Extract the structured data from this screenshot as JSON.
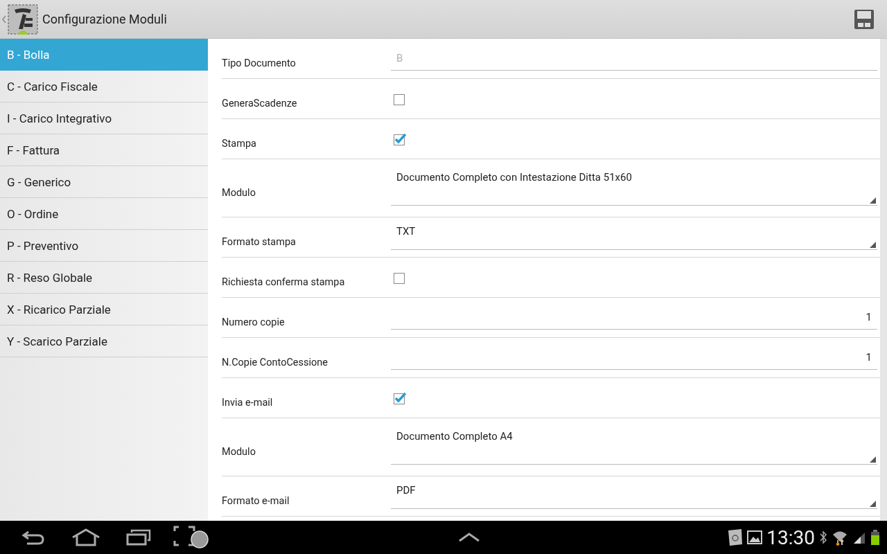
{
  "action_bar": {
    "title": "Configurazione Moduli"
  },
  "sidebar": {
    "items": [
      {
        "label": "B - Bolla",
        "selected": true
      },
      {
        "label": "C - Carico Fiscale",
        "selected": false
      },
      {
        "label": "I - Carico Integrativo",
        "selected": false
      },
      {
        "label": "F - Fattura",
        "selected": false
      },
      {
        "label": "G - Generico",
        "selected": false
      },
      {
        "label": "O - Ordine",
        "selected": false
      },
      {
        "label": "P - Preventivo",
        "selected": false
      },
      {
        "label": "R - Reso Globale",
        "selected": false
      },
      {
        "label": "X - Ricarico Parziale",
        "selected": false
      },
      {
        "label": "Y - Scarico Parziale",
        "selected": false
      }
    ]
  },
  "settings": [
    {
      "kind": "text",
      "label": "Tipo Documento",
      "value": "B",
      "disabled": true
    },
    {
      "kind": "checkbox",
      "label": "GeneraScadenze",
      "checked": false
    },
    {
      "kind": "checkbox",
      "label": "Stampa",
      "checked": true
    },
    {
      "kind": "spinner",
      "label": "Modulo",
      "value": "Documento Completo con Intestazione Ditta 51x60"
    },
    {
      "kind": "spinner",
      "label": "Formato stampa",
      "value": "TXT"
    },
    {
      "kind": "checkbox",
      "label": "Richiesta conferma stampa",
      "checked": false
    },
    {
      "kind": "number",
      "label": "Numero copie",
      "value": "1"
    },
    {
      "kind": "number",
      "label": "N.Copie ContoCessione",
      "value": "1"
    },
    {
      "kind": "checkbox",
      "label": "Invia e-mail",
      "checked": true
    },
    {
      "kind": "spinner",
      "label": "Modulo",
      "value": "Documento Completo A4"
    },
    {
      "kind": "spinner",
      "label": "Formato e-mail",
      "value": "PDF"
    }
  ],
  "system_bar": {
    "time": "13:30"
  }
}
